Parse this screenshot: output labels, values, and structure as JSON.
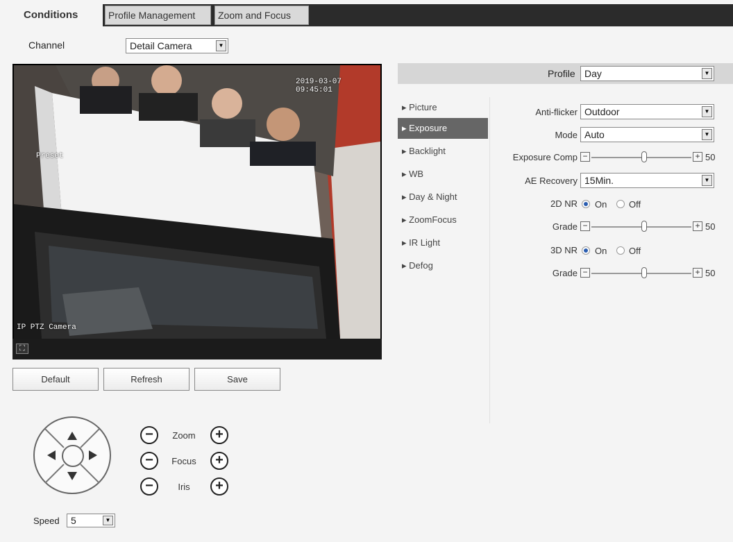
{
  "tabs": [
    {
      "label": "Conditions"
    },
    {
      "label": "Profile Management"
    },
    {
      "label": "Zoom and Focus"
    }
  ],
  "channel": {
    "label": "Channel",
    "value": "Detail Camera"
  },
  "video": {
    "timestamp": "2019-03-07 09:45:01",
    "preset_label": "Preset",
    "camera_name": "IP PTZ Camera",
    "fullscreen_icon": "fullscreen-icon"
  },
  "actions": {
    "default": "Default",
    "refresh": "Refresh",
    "save": "Save"
  },
  "ptz": {
    "zoom": "Zoom",
    "focus": "Focus",
    "iris": "Iris",
    "minus": "−",
    "plus": "+",
    "speed_label": "Speed",
    "speed_value": "5"
  },
  "profile": {
    "label": "Profile",
    "value": "Day"
  },
  "menu": [
    {
      "label": "Picture"
    },
    {
      "label": "Exposure"
    },
    {
      "label": "Backlight"
    },
    {
      "label": "WB"
    },
    {
      "label": "Day & Night"
    },
    {
      "label": "ZoomFocus"
    },
    {
      "label": "IR Light"
    },
    {
      "label": "Defog"
    }
  ],
  "exposure": {
    "anti_flicker": {
      "label": "Anti-flicker",
      "value": "Outdoor"
    },
    "mode": {
      "label": "Mode",
      "value": "Auto"
    },
    "exposure_comp": {
      "label": "Exposure Comp",
      "value": "50"
    },
    "ae_recovery": {
      "label": "AE Recovery",
      "value": "15Min."
    },
    "nr2d": {
      "label": "2D NR",
      "on": "On",
      "off": "Off",
      "selected": "On"
    },
    "grade1": {
      "label": "Grade",
      "value": "50"
    },
    "nr3d": {
      "label": "3D NR",
      "on": "On",
      "off": "Off",
      "selected": "On"
    },
    "grade2": {
      "label": "Grade",
      "value": "50"
    },
    "slider_minus": "−",
    "slider_plus": "+"
  },
  "colors": {
    "accent": "#2a5db0",
    "active_menu": "#666666",
    "tabbar": "#2b2b2b"
  }
}
